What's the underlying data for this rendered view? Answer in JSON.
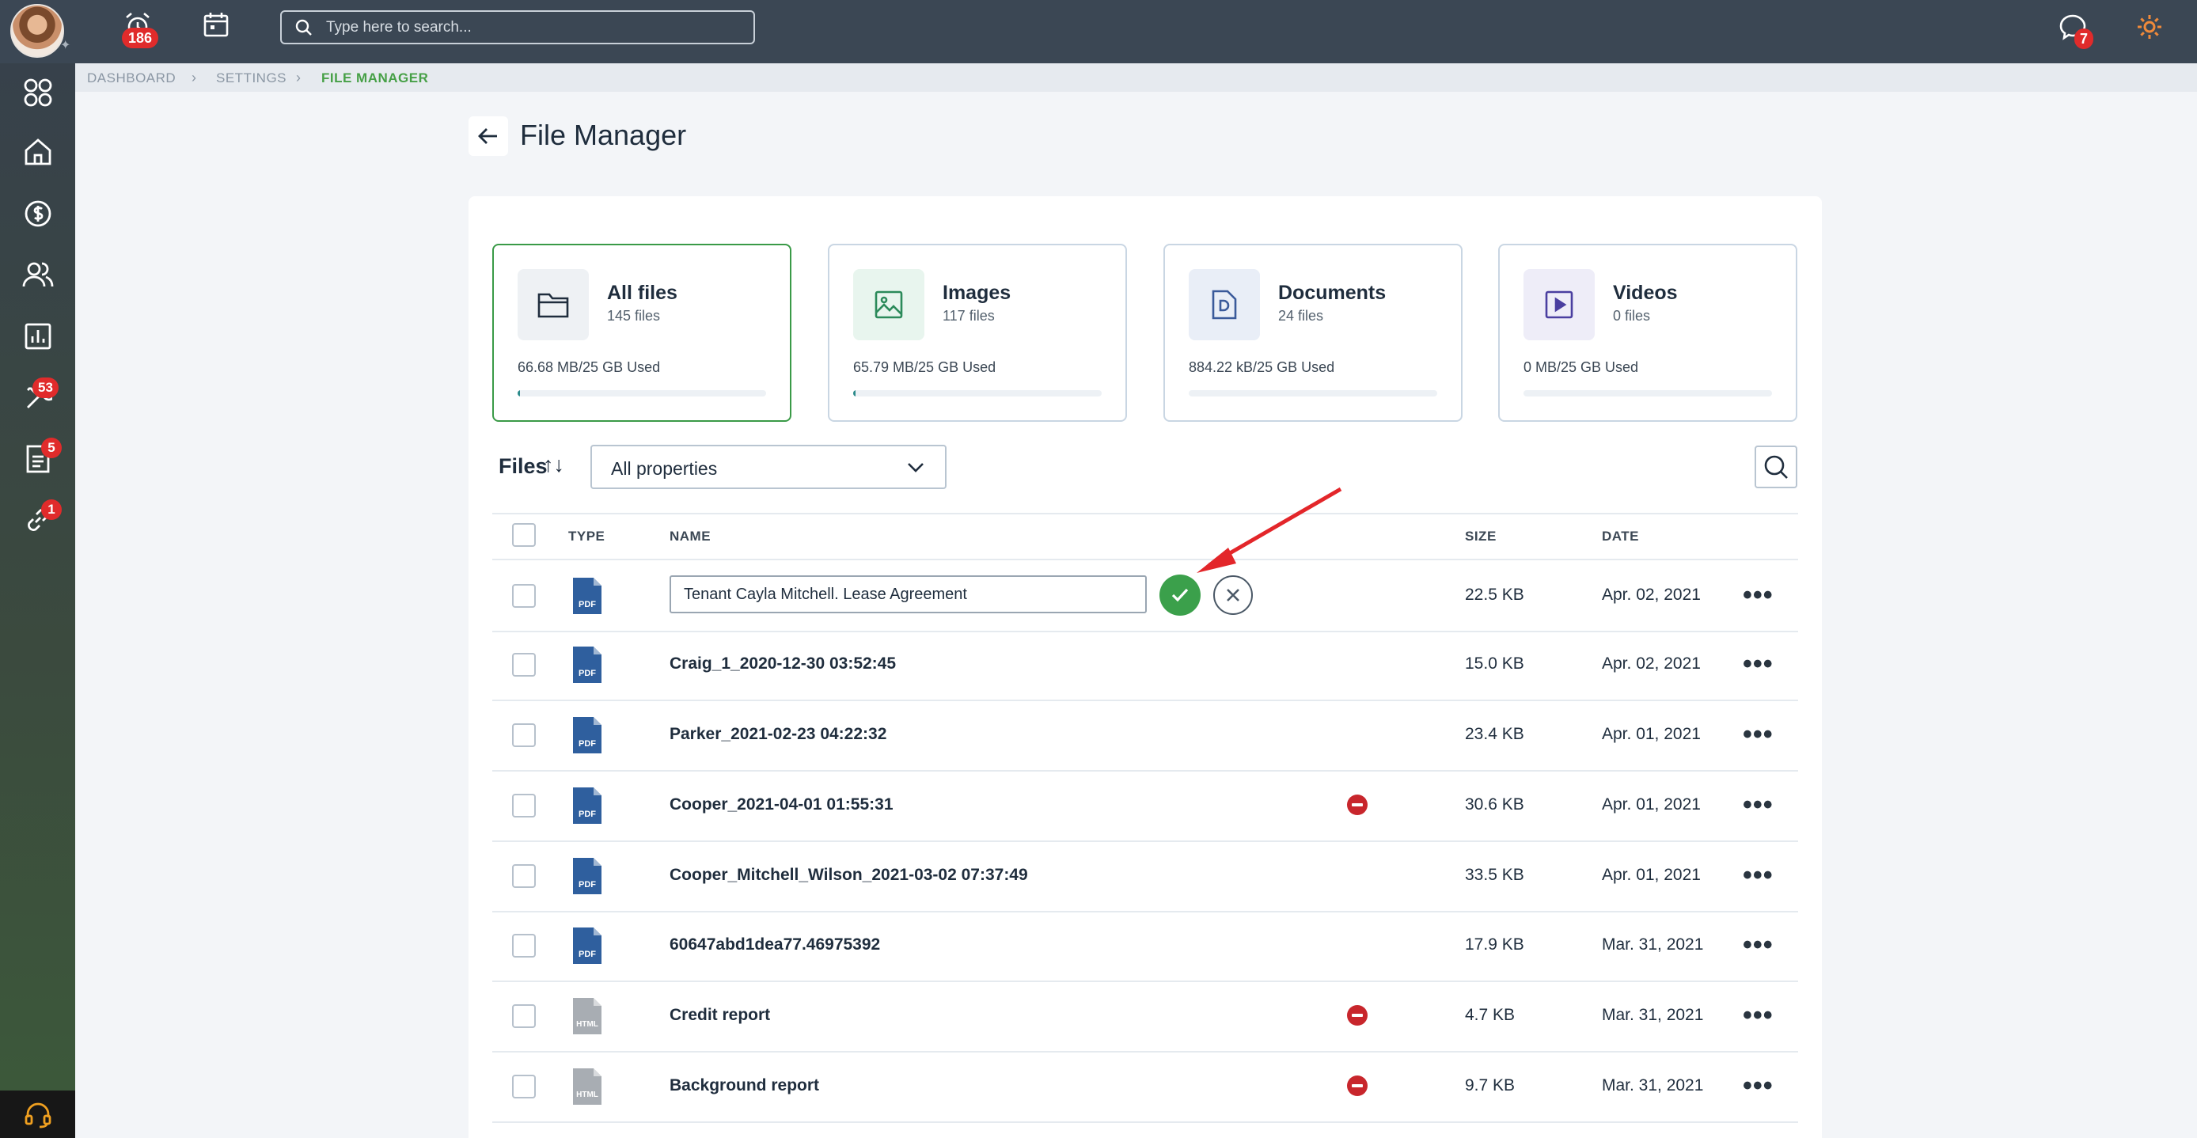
{
  "topbar": {
    "alerts_badge": "186",
    "search_placeholder": "Type here to search...",
    "messages_badge": "7"
  },
  "sidebar": {
    "tools_badge": "53",
    "docs_badge": "5",
    "links_badge": "1"
  },
  "breadcrumb": [
    "DASHBOARD",
    "SETTINGS",
    "FILE MANAGER"
  ],
  "page": {
    "title": "File Manager"
  },
  "stats": [
    {
      "title": "All files",
      "count": "145 files",
      "used": "66.68 MB/25 GB Used",
      "fill": 0.0026,
      "icon": "folder-icon",
      "color": "#1f2d3d"
    },
    {
      "title": "Images",
      "count": "117 files",
      "used": "65.79 MB/25 GB Used",
      "fill": 0.0026,
      "icon": "image-icon",
      "color": "#2b8a5a"
    },
    {
      "title": "Documents",
      "count": "24 files",
      "used": "884.22 kB/25 GB Used",
      "fill": 0.0,
      "icon": "document-icon",
      "color": "#3a5a9a"
    },
    {
      "title": "Videos",
      "count": "0 files",
      "used": "0 MB/25 GB Used",
      "fill": 0.0,
      "icon": "video-icon",
      "color": "#4a3fa0"
    }
  ],
  "files_section": {
    "label": "Files",
    "sort_icon": "↑↓",
    "filter_value": "All properties"
  },
  "table": {
    "headers": {
      "type": "TYPE",
      "name": "NAME",
      "size": "SIZE",
      "date": "DATE"
    },
    "editing_value": "Tenant Cayla Mitchell. Lease Agreement",
    "rows": [
      {
        "type": "PDF",
        "name": "Tenant Cayla Mitchell. Lease Agreement",
        "size": "22.5 KB",
        "date": "Apr. 02, 2021",
        "blocked": false
      },
      {
        "type": "PDF",
        "name": "Craig_1_2020-12-30 03:52:45",
        "size": "15.0 KB",
        "date": "Apr. 02, 2021",
        "blocked": false
      },
      {
        "type": "PDF",
        "name": "Parker_2021-02-23 04:22:32",
        "size": "23.4 KB",
        "date": "Apr. 01, 2021",
        "blocked": false
      },
      {
        "type": "PDF",
        "name": "Cooper_2021-04-01 01:55:31",
        "size": "30.6 KB",
        "date": "Apr. 01, 2021",
        "blocked": true
      },
      {
        "type": "PDF",
        "name": "Cooper_Mitchell_Wilson_2021-03-02 07:37:49",
        "size": "33.5 KB",
        "date": "Apr. 01, 2021",
        "blocked": false
      },
      {
        "type": "PDF",
        "name": "60647abd1dea77.46975392",
        "size": "17.9 KB",
        "date": "Mar. 31, 2021",
        "blocked": false
      },
      {
        "type": "HTML",
        "name": "Credit report",
        "size": "4.7 KB",
        "date": "Mar. 31, 2021",
        "blocked": true
      },
      {
        "type": "HTML",
        "name": "Background report",
        "size": "9.7 KB",
        "date": "Mar. 31, 2021",
        "blocked": true
      }
    ]
  }
}
